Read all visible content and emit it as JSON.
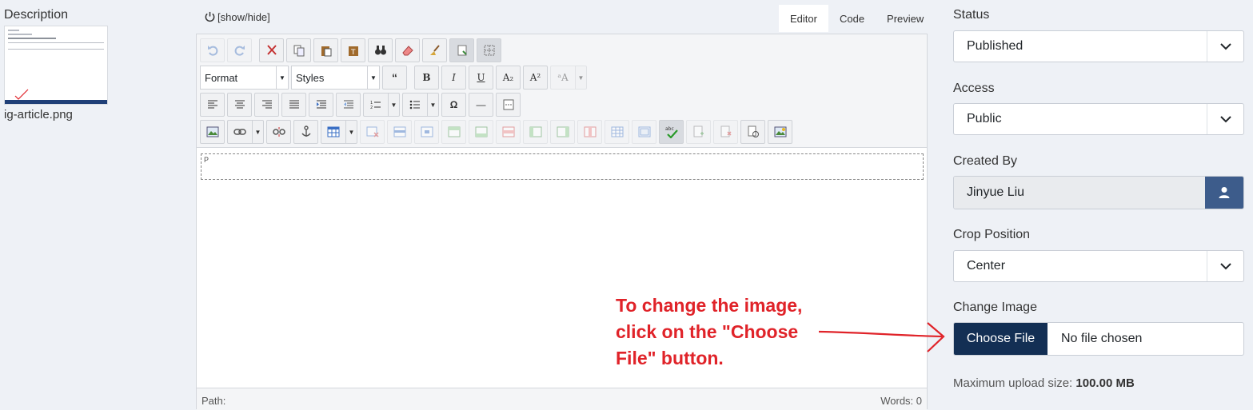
{
  "description": {
    "label": "Description",
    "thumbnail_name": "ig-article.png"
  },
  "editor": {
    "toggle_label": "[show/hide]",
    "tabs": [
      "Editor",
      "Code",
      "Preview"
    ],
    "active_tab": "Editor",
    "format_label": "Format",
    "styles_label": "Styles",
    "paragraph_marker": "P",
    "path_label": "Path:",
    "words_label": "Words: 0"
  },
  "annotation": {
    "text": "To change the image, click on the \"Choose File\" button.",
    "color": "#e02329"
  },
  "sidebar": {
    "status": {
      "label": "Status",
      "value": "Published"
    },
    "access": {
      "label": "Access",
      "value": "Public"
    },
    "created_by": {
      "label": "Created By",
      "value": "Jinyue Liu"
    },
    "crop_position": {
      "label": "Crop Position",
      "value": "Center"
    },
    "change_image": {
      "label": "Change Image",
      "button": "Choose File",
      "file_status": "No file chosen"
    },
    "max_upload": {
      "label": "Maximum upload size:",
      "value": "100.00 MB"
    }
  },
  "colors": {
    "choose_button": "#132f54",
    "user_button": "#3d5c8b",
    "page_bg": "#eef1f6"
  }
}
